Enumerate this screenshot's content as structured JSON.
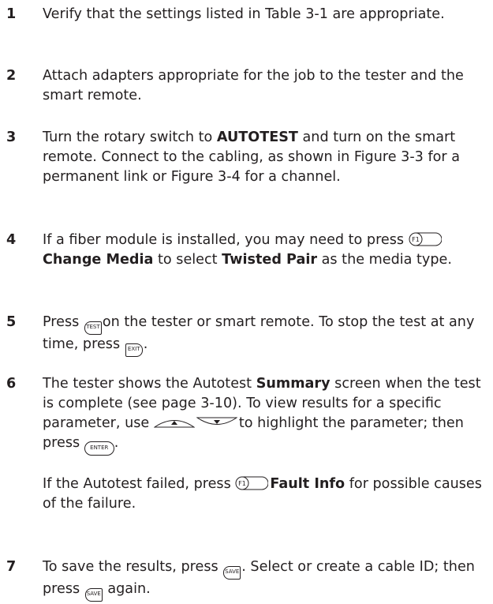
{
  "steps": [
    {
      "num": "1",
      "parts": [
        "Verify that the settings listed in Table 3-1 are appropriate."
      ]
    },
    {
      "num": "2",
      "parts": [
        "Attach adapters appropriate for the job to the tester and the smart remote."
      ]
    },
    {
      "num": "3",
      "t1": "Turn the rotary switch to ",
      "b1": "AUTOTEST",
      "t2": " and turn on the smart remote. Connect to the cabling, as shown in Figure 3-3 for a permanent link or Figure 3-4 for a channel."
    },
    {
      "num": "4",
      "t1": "If a fiber module is installed, you may need to press",
      "b1": "Change Media",
      "t2": " to select ",
      "b2": "Twisted Pair",
      "t3": " as the media type."
    },
    {
      "num": "5",
      "t1": "Press",
      "t2": "on the tester or smart remote. To stop the test at any time, press",
      "t3": "."
    },
    {
      "num": "6",
      "t1": "The tester shows the Autotest ",
      "b1": "Summary",
      "t2": " screen when the test is complete (see page 3-10). To view results for a specific parameter, use",
      "t3": "to highlight the parameter; then press",
      "t4": ".",
      "p2_t1": "If the Autotest failed, press",
      "p2_b1": "Fault Info",
      "p2_t2": " for possible causes of the failure."
    },
    {
      "num": "7",
      "t1": "To save the results, press",
      "t2": ". Select or create a cable ID; then press",
      "t3": " again."
    }
  ],
  "keys": {
    "f1": "F1",
    "test": "TEST",
    "exit": "EXIT",
    "enter": "ENTER",
    "save": "SAVE",
    "up_icon": "up-arrow-key-icon",
    "down_icon": "down-arrow-key-icon"
  }
}
